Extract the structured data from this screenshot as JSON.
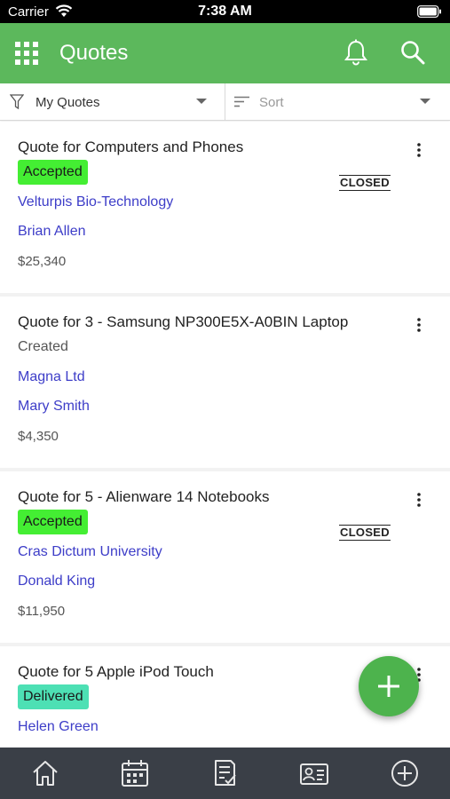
{
  "status_bar": {
    "carrier": "Carrier",
    "time": "7:38 AM"
  },
  "header": {
    "title": "Quotes"
  },
  "filter_bar": {
    "filter_label": "My Quotes",
    "sort_label": "Sort"
  },
  "quotes": [
    {
      "title": "Quote for Computers and Phones",
      "status": "Accepted",
      "account": "Velturpis Bio-Technology",
      "contact": "Brian Allen",
      "amount": "$25,340",
      "closed_label": "CLOSED"
    },
    {
      "title": "Quote for 3 - Samsung NP300E5X-A0BIN Laptop",
      "status": "Created",
      "account": "Magna Ltd",
      "contact": "Mary Smith",
      "amount": "$4,350",
      "closed_label": ""
    },
    {
      "title": "Quote for 5 - Alienware 14 Notebooks",
      "status": "Accepted",
      "account": "Cras Dictum University",
      "contact": "Donald King",
      "amount": "$11,950",
      "closed_label": "CLOSED"
    },
    {
      "title": "Quote for 5 Apple iPod Touch",
      "status": "Delivered",
      "account": "Helen Green",
      "contact": "",
      "amount": "",
      "closed_label": ""
    }
  ],
  "colors": {
    "header_green": "#5cb85c",
    "accepted_badge": "#44ee33",
    "delivered_badge": "#4de0b4",
    "link_blue": "#3d3dc8",
    "fab_green": "#4db34d",
    "tab_bar": "#3a3f47"
  },
  "icons": {
    "header": [
      "apps-grid-icon",
      "bell-icon",
      "search-icon"
    ],
    "tab_bar": [
      "home-icon",
      "calendar-icon",
      "checklist-icon",
      "contact-card-icon",
      "add-circle-icon"
    ],
    "fab": "plus-icon"
  }
}
